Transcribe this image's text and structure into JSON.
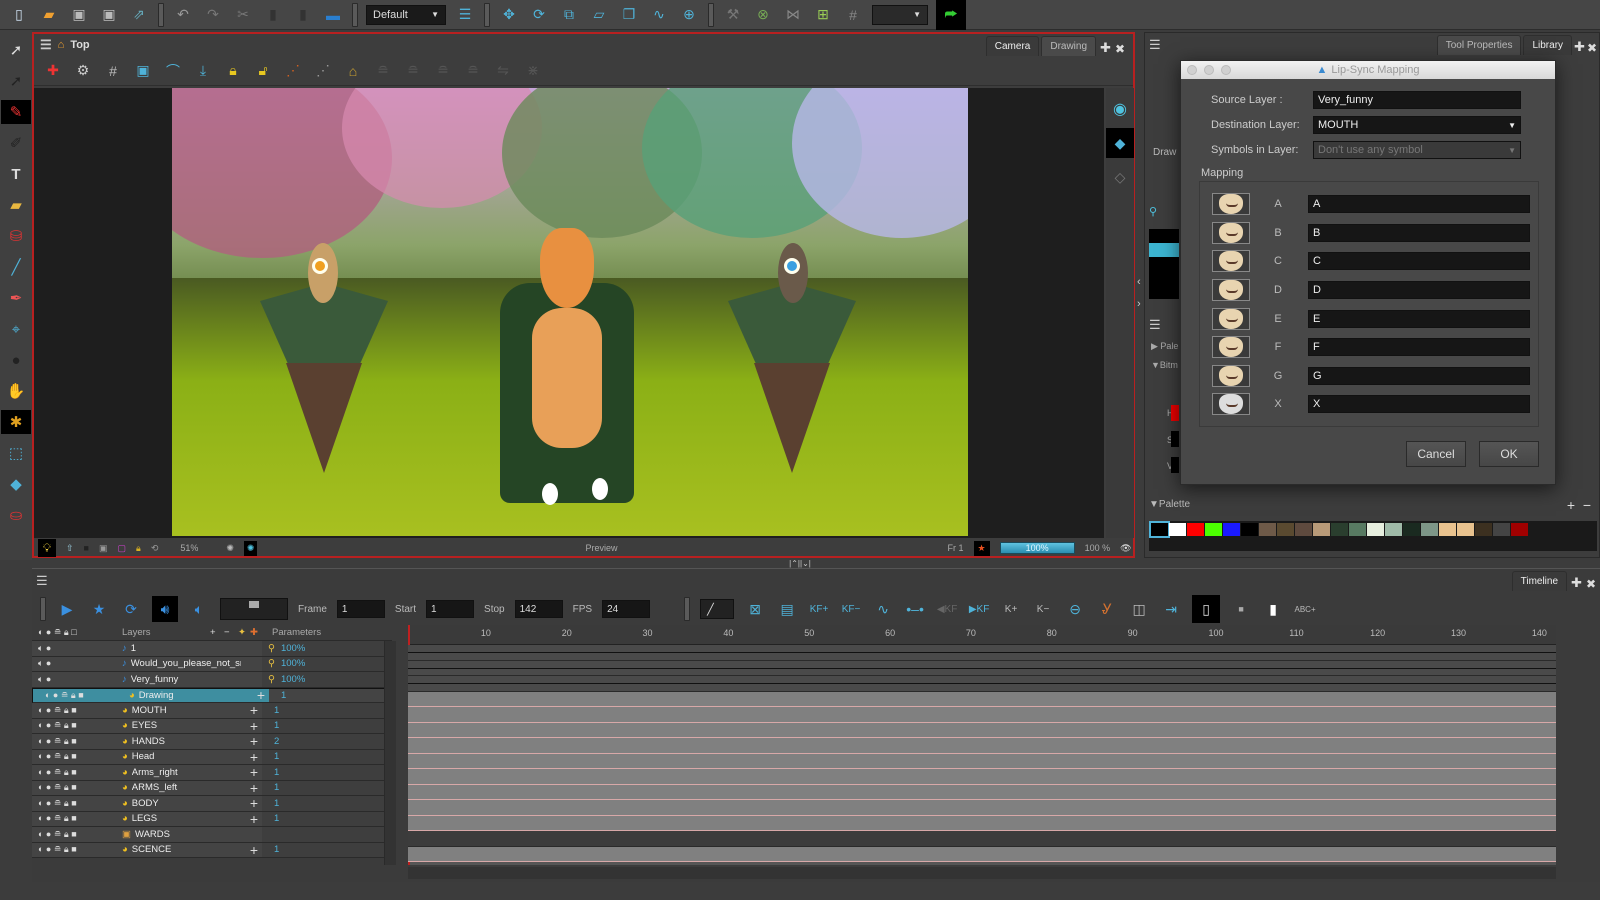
{
  "top_toolbar": {
    "workspace_select": "Default",
    "icons": [
      "new-scene-icon",
      "open-icon",
      "save-icon",
      "save-as-icon",
      "import-icon",
      "undo-icon",
      "redo-icon",
      "cut-icon",
      "copy-icon",
      "paste-icon",
      "library-icon",
      "workspace-icon",
      "transform-icon",
      "rotate-icon",
      "scale-icon",
      "skew-icon",
      "maintain-size-icon",
      "morph-icon",
      "pivot-icon",
      "rigging-tool-icon",
      "cutter-icon",
      "deformation-icon",
      "add-deformer-icon",
      "bone-icon",
      "render-icon"
    ]
  },
  "camera_view": {
    "breadcrumb": "Top",
    "tabs": [
      {
        "label": "Camera",
        "active": true
      },
      {
        "label": "Drawing",
        "active": false
      }
    ],
    "status": {
      "zoom": "51%",
      "preview_label": "Preview",
      "frame_label": "Fr 1",
      "render_progress": "100%",
      "render_progress_value": 100,
      "opacity": "100 %"
    }
  },
  "right_panel": {
    "tabs": [
      {
        "label": "Tool Properties",
        "active": false
      },
      {
        "label": "Library",
        "active": true
      }
    ],
    "partial_labels": {
      "drawing": "Draw",
      "palettes": "Pale",
      "bitmap": "Bitm"
    },
    "hsv": [
      "H",
      "S",
      "V"
    ],
    "palette": {
      "title": "Palette",
      "swatches": [
        "#000000",
        "#ffffff",
        "#ff0000",
        "#4cff00",
        "#1a1aff",
        "#000000",
        "#6e5a48",
        "#5a4a30",
        "#5e4a3e",
        "#b89a78",
        "#2a3e2e",
        "#587a62",
        "#e6eede",
        "#9fbaa8",
        "#1a2a20",
        "#7d9687",
        "#e8c28e",
        "#e8c28e",
        "#3c3020",
        "#444444",
        "#a00000"
      ]
    }
  },
  "lipsync_dialog": {
    "title": "Lip-Sync Mapping",
    "source_layer_label": "Source Layer :",
    "source_layer_value": "Very_funny",
    "destination_layer_label": "Destination Layer:",
    "destination_layer_value": "MOUTH",
    "symbols_label": "Symbols in Layer:",
    "symbols_value": "Don't use any symbol",
    "mapping_label": "Mapping",
    "mapping": [
      {
        "phoneme": "A",
        "drawing": "A"
      },
      {
        "phoneme": "B",
        "drawing": "B"
      },
      {
        "phoneme": "C",
        "drawing": "C"
      },
      {
        "phoneme": "D",
        "drawing": "D"
      },
      {
        "phoneme": "E",
        "drawing": "E"
      },
      {
        "phoneme": "F",
        "drawing": "F"
      },
      {
        "phoneme": "G",
        "drawing": "G"
      },
      {
        "phoneme": "X",
        "drawing": "X"
      }
    ],
    "cancel_label": "Cancel",
    "ok_label": "OK"
  },
  "timeline": {
    "tab_label": "Timeline",
    "frame_label": "Frame",
    "frame_value": "1",
    "start_label": "Start",
    "start_value": "1",
    "stop_label": "Stop",
    "stop_value": "142",
    "fps_label": "FPS",
    "fps_value": "24",
    "layers_header": "Layers",
    "parameters_header": "Parameters",
    "ruler_ticks": [
      "10",
      "20",
      "30",
      "40",
      "50",
      "60",
      "70",
      "80",
      "90",
      "100",
      "110",
      "120",
      "130",
      "140"
    ],
    "layers": [
      {
        "name": "1",
        "type": "sound",
        "param": "100%"
      },
      {
        "name": "Would_you_please_not_smo",
        "type": "sound",
        "param": "100%"
      },
      {
        "name": "Very_funny",
        "type": "sound",
        "param": "100%"
      },
      {
        "name": "Drawing",
        "type": "drawing",
        "param": "1",
        "selected": true
      },
      {
        "name": "MOUTH",
        "type": "drawing",
        "param": "1"
      },
      {
        "name": "EYES",
        "type": "drawing",
        "param": "1"
      },
      {
        "name": "HANDS",
        "type": "drawing",
        "param": "2"
      },
      {
        "name": "Head",
        "type": "drawing",
        "param": "1"
      },
      {
        "name": "Arms_right",
        "type": "drawing",
        "param": "1"
      },
      {
        "name": "ARMS_left",
        "type": "drawing",
        "param": "1"
      },
      {
        "name": "BODY",
        "type": "drawing",
        "param": "1"
      },
      {
        "name": "LEGS",
        "type": "drawing",
        "param": "1"
      },
      {
        "name": "WARDS",
        "type": "group",
        "param": ""
      },
      {
        "name": "SCENCE",
        "type": "drawing",
        "param": "1"
      }
    ]
  }
}
